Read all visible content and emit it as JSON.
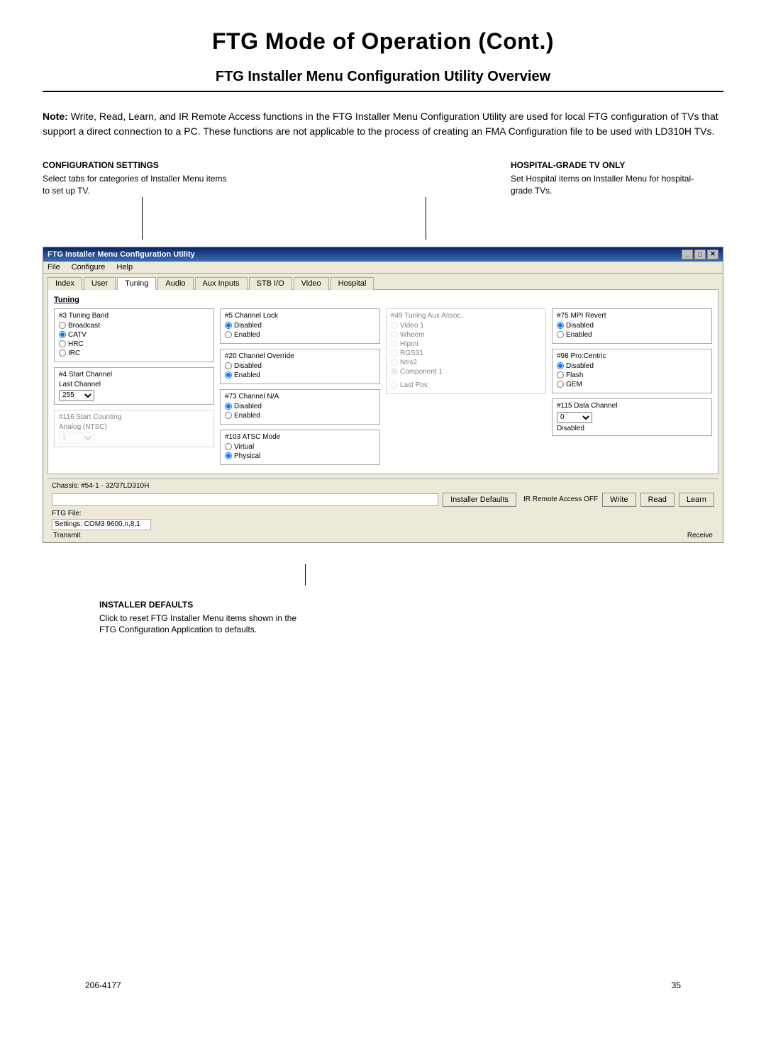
{
  "page": {
    "title": "FTG Mode of Operation (Cont.)",
    "subtitle": "FTG Installer Menu Configuration Utility Overview",
    "footer_left": "206-4177",
    "footer_right": "35"
  },
  "note": {
    "label": "Note:",
    "text": " Write, Read, Learn, and IR Remote Access functions in the FTG Installer Menu Configuration Utility are used for local FTG configuration of TVs that support a direct connection to a PC. These functions are not applicable to the process of creating an FMA Configuration file to be used with LD310H TVs."
  },
  "annotations": {
    "config_settings": {
      "title": "CONFIGURATION SETTINGS",
      "text": "Select tabs for categories of Installer Menu items to set up TV."
    },
    "hospital_grade": {
      "title": "HOSPITAL-GRADE TV ONLY",
      "text": "Set Hospital items on Installer Menu for hospital-grade TVs."
    },
    "installer_defaults": {
      "title": "INSTALLER DEFAULTS",
      "text": "Click to reset FTG Installer Menu items shown in the FTG Configuration Application to defaults."
    }
  },
  "window": {
    "title": "FTG Installer Menu Configuration Utility",
    "menu_items": [
      "File",
      "Configure",
      "Help"
    ],
    "tabs": [
      "Index",
      "User",
      "Tuning",
      "Audio",
      "Aux Inputs",
      "STB I/O",
      "Video",
      "Hospital"
    ],
    "active_tab": "Tuning",
    "section_label": "Tuning",
    "col1": {
      "group1_title": "#3 Tuning Band",
      "broadcast_label": "Broadcast",
      "catv_label": "CATV",
      "hrc_label": "HRC",
      "irc_label": "IRC",
      "group2_title": "#4 Start Channel",
      "last_channel_label": "Last Channel",
      "start_channel_value": "255",
      "group3_title": "#116 Start Counting",
      "analog_ntsc_label": "Analog (NTSC)",
      "start_count_value": "1"
    },
    "col2": {
      "group1_title": "#5 Channel Lock",
      "disabled_label": "Disabled",
      "enabled_label": "Enabled",
      "group2_title": "#20 Channel Override",
      "disabled2_label": "Disabled",
      "enabled2_label": "Enabled",
      "group3_title": "#73 Channel N/A",
      "disabled3_label": "Disabled",
      "enabled3_label": "Enabled",
      "group4_title": "#103 ATSC Mode",
      "virtual_label": "Virtual",
      "physical_label": "Physical"
    },
    "col3": {
      "group1_title": "#49 Tuning Aux Assoc.",
      "video1_label": "Video 1",
      "wheem_label": "Wheem",
      "hipmi_label": "Hipmi",
      "rgs31_label": "RGS31",
      "ntrs2_label": "Ntrs2",
      "component_label": "Component 1",
      "last_pos_label": "Last Pos"
    },
    "col4": {
      "group1_title": "#75 MPI Revert",
      "disabled_label": "Disabled",
      "enabled_label": "Enabled",
      "group2_title": "#98 Pro:Centric",
      "disabled2_label": "Disabled",
      "flash_label": "Flash",
      "gem_label": "GEM",
      "group3_title": "#115 Data Channel",
      "data_channel_value": "0",
      "disabled3_label": "Disabled"
    },
    "chassis": "Chassis:  #54-1 - 32/37LD310H",
    "installer_defaults_btn": "Installer Defaults",
    "ir_remote_label": "IR Remote Access OFF",
    "write_btn": "Write",
    "read_btn": "Read",
    "learn_btn": "Learn",
    "ftg_file_label": "FTG File:",
    "settings_value": "Settings: COM3 9600,n,8,1",
    "transmit_label": "Transmit",
    "receive_label": "Receive"
  }
}
